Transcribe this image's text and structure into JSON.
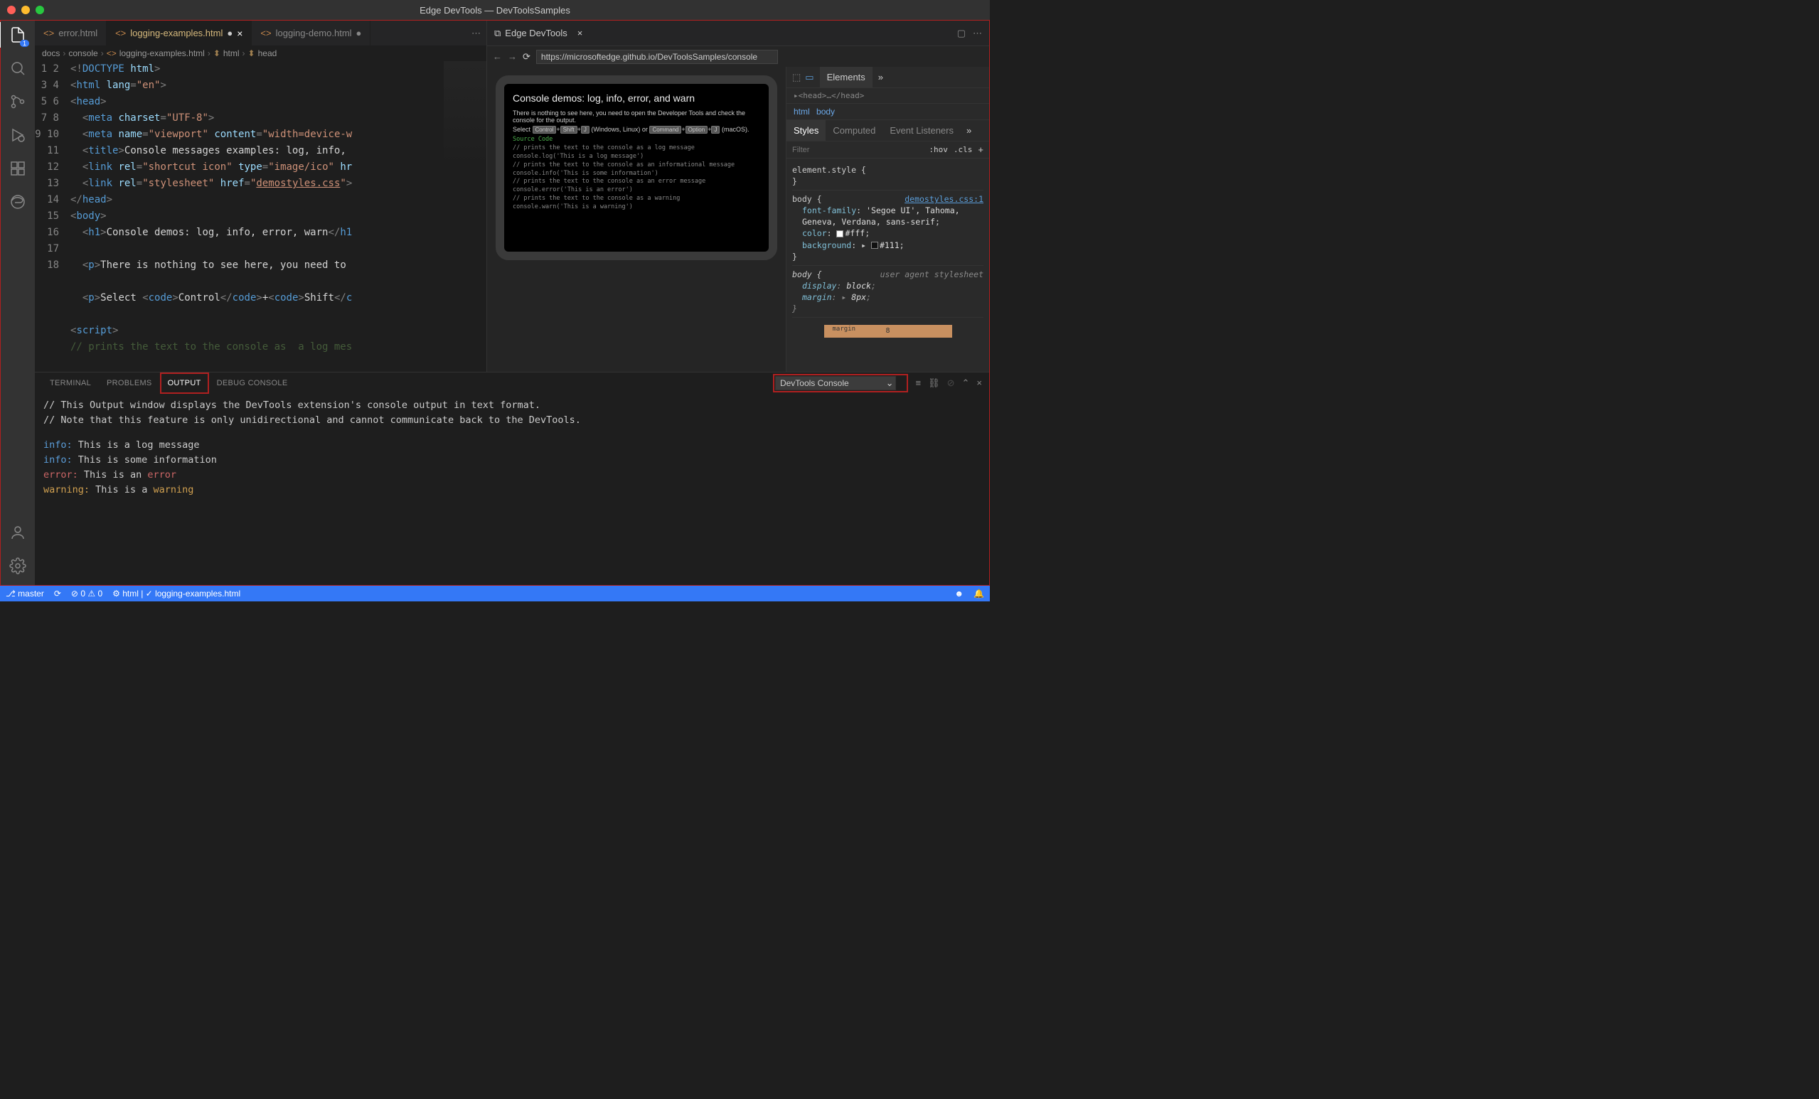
{
  "titleBar": {
    "title": "Edge DevTools — DevToolsSamples"
  },
  "activityBar": {
    "badge": "1"
  },
  "editorTabs": [
    {
      "label": "error.html",
      "active": false,
      "dirty": false
    },
    {
      "label": "logging-examples.html",
      "active": true,
      "dirty": true
    },
    {
      "label": "logging-demo.html",
      "active": false,
      "dirty": true
    }
  ],
  "breadcrumbs": {
    "parts": [
      "docs",
      "console",
      "logging-examples.html",
      "html",
      "head"
    ]
  },
  "code": {
    "lines": [
      1,
      2,
      3,
      4,
      5,
      6,
      7,
      8,
      9,
      10,
      11,
      12,
      13,
      14,
      15,
      16,
      17,
      18
    ]
  },
  "devtoolsTab": {
    "label": "Edge DevTools"
  },
  "urlBar": {
    "value": "https://microsoftedge.github.io/DevToolsSamples/console"
  },
  "elementsTabs": [
    "Elements"
  ],
  "domLine": "▸<head>…</head>",
  "domBreadcrumb": [
    "html",
    "body"
  ],
  "stylesTabs": [
    "Styles",
    "Computed",
    "Event Listeners"
  ],
  "filter": {
    "placeholder": "Filter",
    "hov": ":hov",
    "cls": ".cls"
  },
  "cssRules": [
    {
      "selector": "element.style {",
      "props": [],
      "close": "}",
      "link": ""
    },
    {
      "selector": "body {",
      "link": "demostyles.css:1",
      "props": [
        {
          "name": "font-family",
          "value": "'Segoe UI', Tahoma, Geneva, Verdana, sans-serif"
        },
        {
          "name": "color",
          "value": "#fff",
          "swatch": "#fff"
        },
        {
          "name": "background",
          "value": "#111",
          "swatch": "#111",
          "expand": true
        }
      ],
      "close": "}"
    },
    {
      "selector": "body {",
      "link": "",
      "ua": "user agent stylesheet",
      "italic": true,
      "props": [
        {
          "name": "display",
          "value": "block"
        },
        {
          "name": "margin",
          "value": "8px",
          "expand": true
        }
      ],
      "close": "}"
    }
  ],
  "boxModel": {
    "label": "margin",
    "value": "8"
  },
  "preview": {
    "heading": "Console demos: log, info, error, and warn",
    "sub": "There is nothing to see here, you need to open the Developer Tools and check the console for the output.",
    "selectLine": "Select",
    "kbds1": [
      "Control",
      "Shift",
      "J"
    ],
    "mid": "(Windows, Linux) or",
    "kbds2": [
      "Command",
      "Option",
      "J"
    ],
    "end": "(macOS).",
    "sourceCodeLabel": "Source Code",
    "codeLines": [
      "// prints the text to the console as  a log message",
      "console.log('This is a log message')",
      "// prints the text to the console as an informational message",
      "console.info('This is some information')",
      "// prints the text to the console as an error message",
      "console.error('This is an error')",
      "// prints the text to the console as a warning",
      "console.warn('This is a warning')"
    ]
  },
  "bottomTabs": [
    "TERMINAL",
    "PROBLEMS",
    "OUTPUT",
    "DEBUG CONSOLE"
  ],
  "activeBottomTab": "OUTPUT",
  "outputChannel": "DevTools Console",
  "output": {
    "comment1": "// This Output window displays the DevTools extension's console output in text format.",
    "comment2": "// Note that this feature is only unidirectional and cannot communicate back to the DevTools.",
    "lines": [
      {
        "level": "info",
        "text": "This is a log message"
      },
      {
        "level": "info",
        "text": "This is some information"
      },
      {
        "level": "error",
        "text": "This is an ",
        "highlight": "error"
      },
      {
        "level": "warning",
        "text": "This is a ",
        "highlight": "warning"
      }
    ]
  },
  "statusBar": {
    "branch": "master",
    "errors": "0",
    "warnings": "0",
    "lang": "html",
    "file": "logging-examples.html"
  }
}
